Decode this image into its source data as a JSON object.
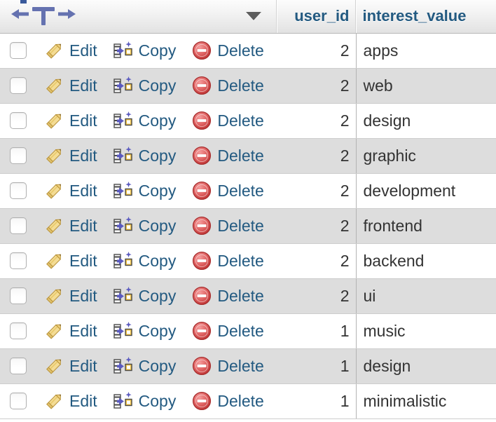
{
  "table": {
    "headers": {
      "actions": "",
      "user_id": "user_id",
      "interest_value": "interest_value"
    },
    "row_actions": {
      "edit": "Edit",
      "copy": "Copy",
      "delete": "Delete"
    },
    "icons": {
      "sort_move": "sort-move-icon",
      "dropdown": "chevron-down-icon",
      "edit": "pencil-icon",
      "copy": "copy-icon",
      "delete": "delete-circle-icon",
      "checkbox": "checkbox-unchecked-icon"
    },
    "rows": [
      {
        "user_id": "2",
        "interest_value": "apps"
      },
      {
        "user_id": "2",
        "interest_value": "web"
      },
      {
        "user_id": "2",
        "interest_value": "design"
      },
      {
        "user_id": "2",
        "interest_value": "graphic"
      },
      {
        "user_id": "2",
        "interest_value": "development"
      },
      {
        "user_id": "2",
        "interest_value": "frontend"
      },
      {
        "user_id": "2",
        "interest_value": "backend"
      },
      {
        "user_id": "2",
        "interest_value": "ui"
      },
      {
        "user_id": "1",
        "interest_value": "music"
      },
      {
        "user_id": "1",
        "interest_value": "design"
      },
      {
        "user_id": "1",
        "interest_value": "minimalistic"
      }
    ]
  },
  "colors": {
    "link": "#235a81",
    "header_text": "#235a81",
    "row_odd": "#ffffff",
    "row_even": "#dddddd",
    "delete_red": "#d94f4f",
    "pencil_yellow": "#f2d98b",
    "copy_purple": "#5b5bc0"
  }
}
